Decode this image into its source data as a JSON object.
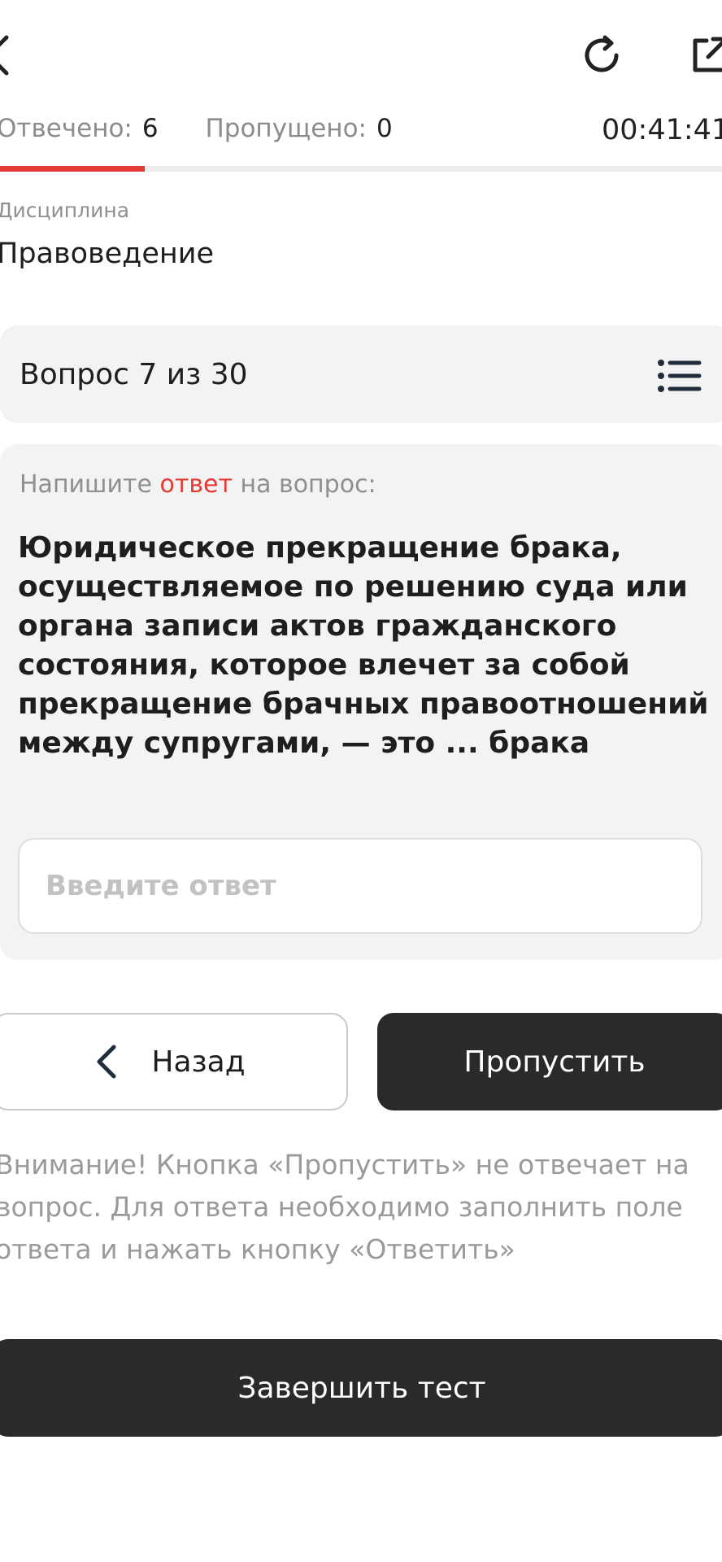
{
  "header": {
    "back_icon": "chevron-left-icon",
    "reload_icon": "reload-icon",
    "share_icon": "external-link-icon"
  },
  "stats": {
    "answered_label": "Отвечено:",
    "answered_value": "6",
    "skipped_label": "Пропущено:",
    "skipped_value": "0",
    "timer": "00:41:41"
  },
  "progress": {
    "fraction": 0.2,
    "color": "#e53935"
  },
  "discipline": {
    "label": "Дисциплина",
    "value": "Правоведение"
  },
  "question_bar": {
    "counter": "Вопрос 7 из 30",
    "list_icon": "list-icon"
  },
  "question": {
    "instruction_before": "Напишите",
    "instruction_accent": "ответ",
    "instruction_after": "на вопрос:",
    "text": "Юридическое прекращение брака, осуществляемое по решению суда или органа записи актов гражданского состояния, которое влечет за собой прекращение брачных правоотношений между супругами, — это ... брака",
    "input_value": "",
    "input_placeholder": "Введите ответ"
  },
  "buttons": {
    "back_label": "Назад",
    "skip_label": "Пропустить",
    "finish_label": "Завершить тест"
  },
  "warning": "Внимание! Кнопка «Пропустить» не отвечает на вопрос. Для ответа необходимо заполнить поле ответа и нажать кнопку «Ответить»",
  "colors": {
    "accent": "#e53935",
    "dark_button": "#2a2a2a",
    "card_background": "#f3f3f3"
  }
}
